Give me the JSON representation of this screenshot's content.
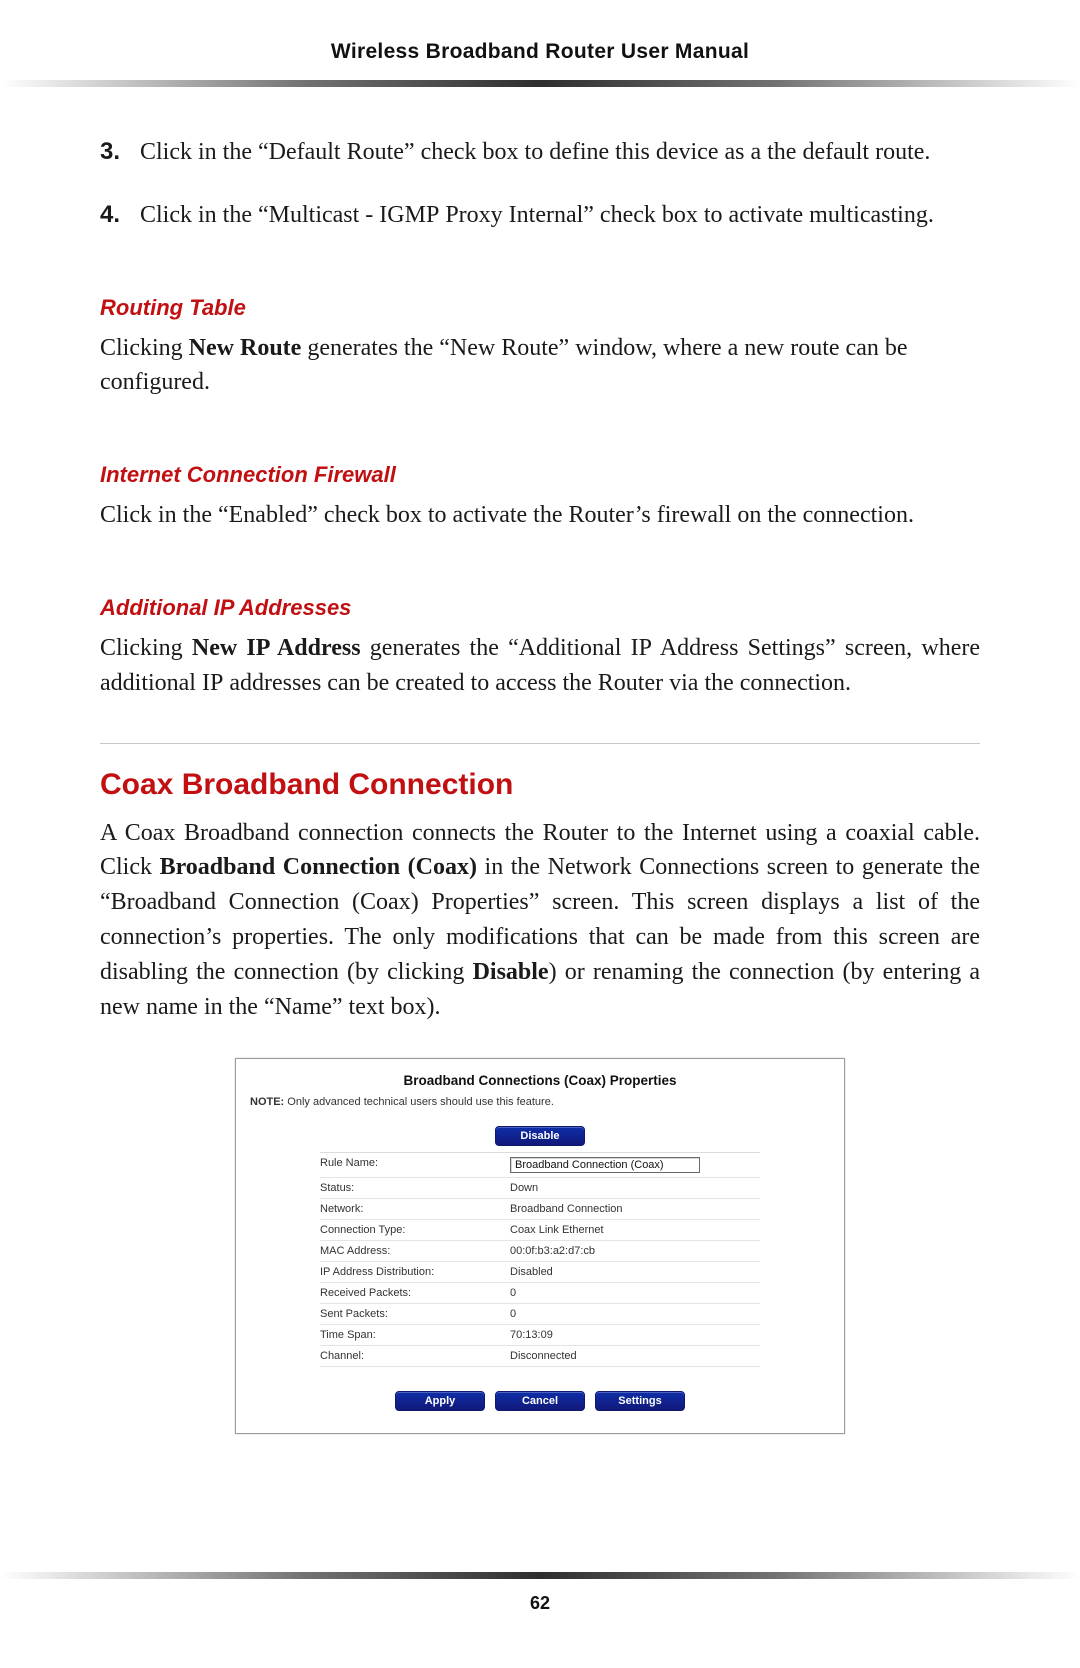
{
  "running_head": "Wireless Broadband Router User Manual",
  "steps": [
    {
      "n": "3.",
      "text": "Click in the “Default Route” check box to define this device as a the default route."
    },
    {
      "n": "4.",
      "text_pre": "Click in the “Multicast - ",
      "smallcaps": "IGMP",
      "text_post": " Proxy Internal” check box to activate multicasting."
    }
  ],
  "sections": {
    "routing_table": {
      "heading": "Routing Table",
      "para_pre": "Clicking ",
      "para_bold": "New Route",
      "para_post": " generates the “New Route” window, where a new route can be configured."
    },
    "firewall": {
      "heading": "Internet Connection Firewall",
      "para": "Click in the “Enabled” check box to activate the Router’s firewall on the connection."
    },
    "add_ip": {
      "heading": "Additional IP Addresses",
      "para_pre": "Clicking ",
      "para_bold": "New IP Address",
      "para_mid": " generates the “Additional ",
      "smallcaps1": "IP",
      "para_mid2": " Address Settings” screen, where additional ",
      "smallcaps2": "IP",
      "para_post": " addresses can be created to access the Router via the connection."
    }
  },
  "coax": {
    "heading": "Coax Broadband Connection",
    "p1": "A Coax Broadband connection connects the Router to the Internet using a coaxial cable",
    "p2_pre": ". Click ",
    "p2_bold": "Broadband Connection (Coax)",
    "p2_post": " in the Network Connections screen to generate the “Broadband Connection (Coax) Properties” screen. This screen displays a list of the connection’s properties. The only modifications that can be made from this screen are disabling the connection (by clicking ",
    "p2_bold2": "Disable",
    "p2_tail": ") or renaming the connection (by entering a new name in the “Name” text box)."
  },
  "panel": {
    "title": "Broadband Connections (Coax) Properties",
    "note_label": "NOTE:",
    "note_text": " Only advanced technical users should use this feature.",
    "disable": "Disable",
    "rows": [
      {
        "k": "Rule Name:",
        "v": "Broadband Connection (Coax)",
        "input": true
      },
      {
        "k": "Status:",
        "v": "Down"
      },
      {
        "k": "Network:",
        "v": "Broadband Connection"
      },
      {
        "k": "Connection Type:",
        "v": "Coax Link Ethernet"
      },
      {
        "k": "MAC Address:",
        "v": "00:0f:b3:a2:d7:cb"
      },
      {
        "k": "IP Address Distribution:",
        "v": "Disabled"
      },
      {
        "k": "Received Packets:",
        "v": "0"
      },
      {
        "k": "Sent Packets:",
        "v": "0"
      },
      {
        "k": "Time Span:",
        "v": "70:13:09"
      },
      {
        "k": "Channel:",
        "v": "Disconnected"
      }
    ],
    "buttons": {
      "apply": "Apply",
      "cancel": "Cancel",
      "settings": "Settings"
    }
  },
  "page_number": "62"
}
